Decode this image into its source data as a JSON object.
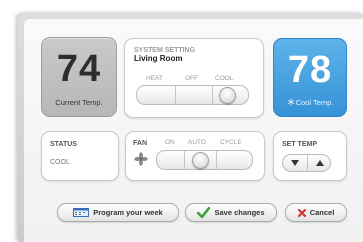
{
  "current": {
    "temp": "74",
    "label": "Current Temp."
  },
  "system": {
    "title": "SYSTEM SETTING",
    "room": "Living Room",
    "modes": [
      "HEAT",
      "OFF",
      "COOL"
    ],
    "selected": "COOL"
  },
  "cool": {
    "temp": "78",
    "label": "Cool Temp.",
    "icon": "snowflake-icon"
  },
  "status": {
    "title": "STATUS",
    "value": "COOL"
  },
  "fan": {
    "title": "FAN",
    "modes": [
      "ON",
      "AUTO",
      "CYCLE"
    ],
    "selected": "AUTO",
    "icon": "fan-icon"
  },
  "set_temp": {
    "title": "SET TEMP",
    "down": "down-arrow-icon",
    "up": "up-arrow-icon"
  },
  "buttons": {
    "program": "Program your week",
    "save": "Save changes",
    "cancel": "Cancel"
  },
  "colors": {
    "cool_accent": "#3592d6",
    "save_check": "#3aa335",
    "cancel_x": "#d0312d",
    "program_icon": "#3b6fb6"
  }
}
